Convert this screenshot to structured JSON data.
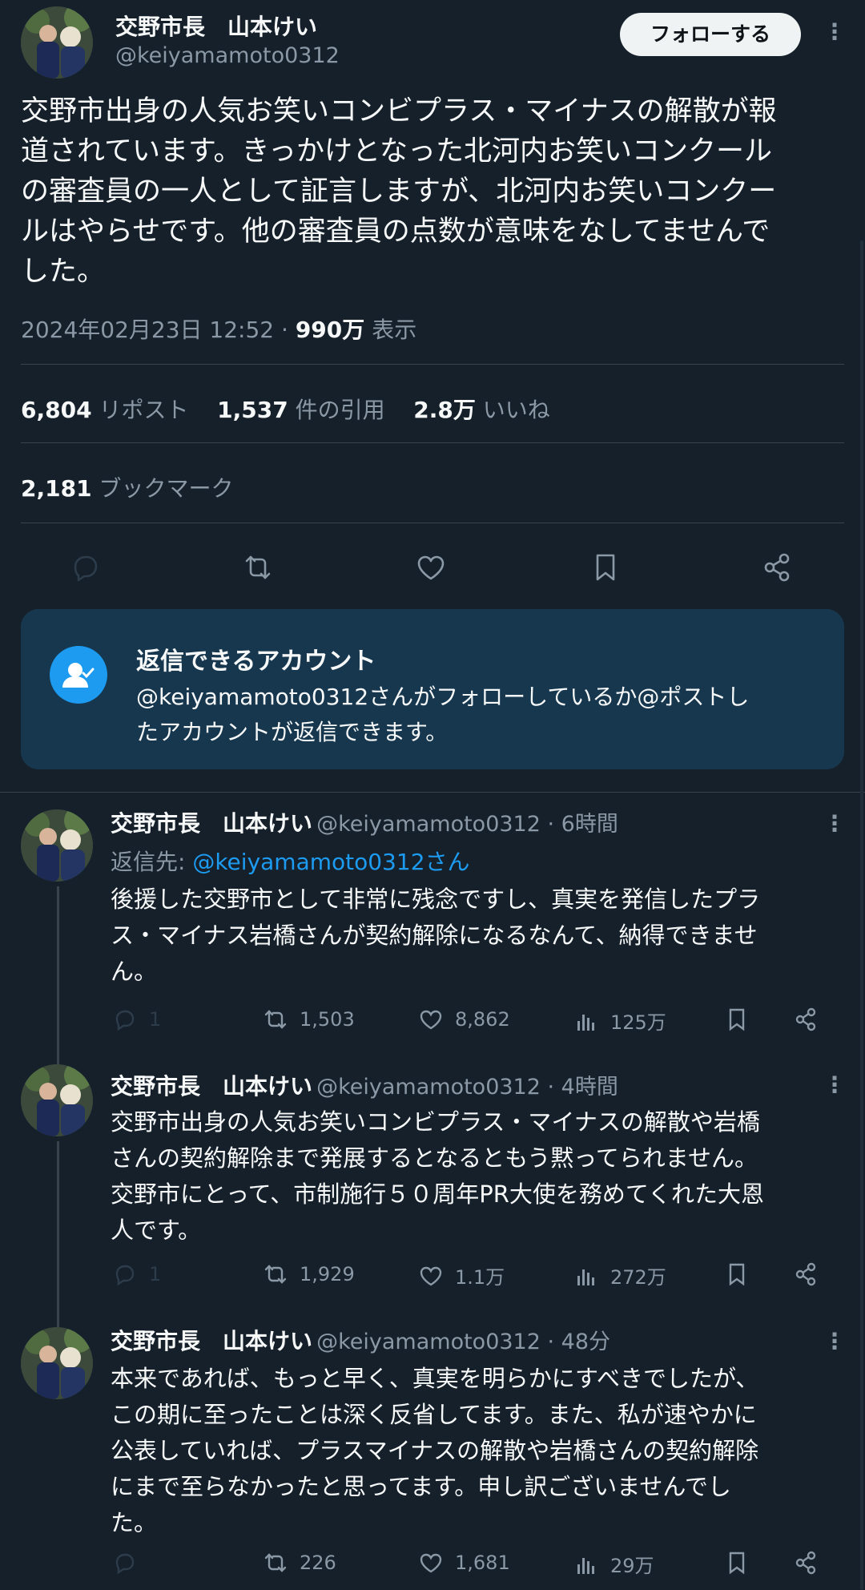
{
  "tweet": {
    "display_name": "交野市長　山本けい",
    "handle": "@keiyamamoto0312",
    "follow_label": "フォローする",
    "text_lines": [
      "交野市出身の人気お笑いコンビプラス・マイナスの解散が報",
      "道されています。きっかけとなった北河内お笑いコンクール",
      "の審査員の一人として証言しますが、北河内お笑いコンクー",
      "ルはやらせです。他の審査員の点数が意味をなしてませんで",
      "した。"
    ],
    "timestamp": "2024年02月23日 12:52 ·",
    "views_count": "990万",
    "views_label": "表示"
  },
  "stats": {
    "reposts_count": "6,804",
    "reposts_label": "リポスト",
    "quotes_count": "1,537",
    "quotes_label": "件の引用",
    "likes_count": "2.8万",
    "likes_label": "いいね",
    "bookmarks_count": "2,181",
    "bookmarks_label": "ブックマーク"
  },
  "notice": {
    "title": "返信できるアカウント",
    "body_lines": [
      "@keiyamamoto0312さんがフォローしているか@ポストし",
      "たアカウントが返信できます。"
    ]
  },
  "replies": [
    {
      "display_name": "交野市長　山本けい",
      "handle_time": "@keiyamamoto0312 · 6時間",
      "reply_to_prefix": "返信先: ",
      "reply_to_handle": "@keiyamamoto0312さん",
      "text_lines": [
        "後援した交野市として非常に残念ですし、真実を発信したプラ",
        "ス・マイナス岩橋さんが契約解除になるなんて、納得できませ",
        "ん。"
      ],
      "replies": "1",
      "reposts": "1,503",
      "likes": "8,862",
      "views": "125万"
    },
    {
      "display_name": "交野市長　山本けい",
      "handle_time": "@keiyamamoto0312 · 4時間",
      "text_lines": [
        "交野市出身の人気お笑いコンビプラス・マイナスの解散や岩橋",
        "さんの契約解除まで発展するとなるともう黙ってられません。",
        "交野市にとって、市制施行５０周年PR大使を務めてくれた大恩",
        "人です。"
      ],
      "replies": "1",
      "reposts": "1,929",
      "likes": "1.1万",
      "views": "272万"
    },
    {
      "display_name": "交野市長　山本けい",
      "handle_time": "@keiyamamoto0312 · 48分",
      "text_lines": [
        "本来であれば、もっと早く、真実を明らかにすべきでしたが、",
        "この期に至ったことは深く反省してます。また、私が速やかに",
        "公表していれば、プラスマイナスの解散や岩橋さんの契約解除",
        "にまで至らなかったと思ってます。申し訳ございませんでし",
        "た。"
      ],
      "replies": "",
      "reposts": "226",
      "likes": "1,681",
      "views": "29万"
    }
  ],
  "colors": {
    "background": "#15202b",
    "accent": "#1d9bf0",
    "muted": "#8b98a5",
    "notice_bg": "#17374f"
  }
}
